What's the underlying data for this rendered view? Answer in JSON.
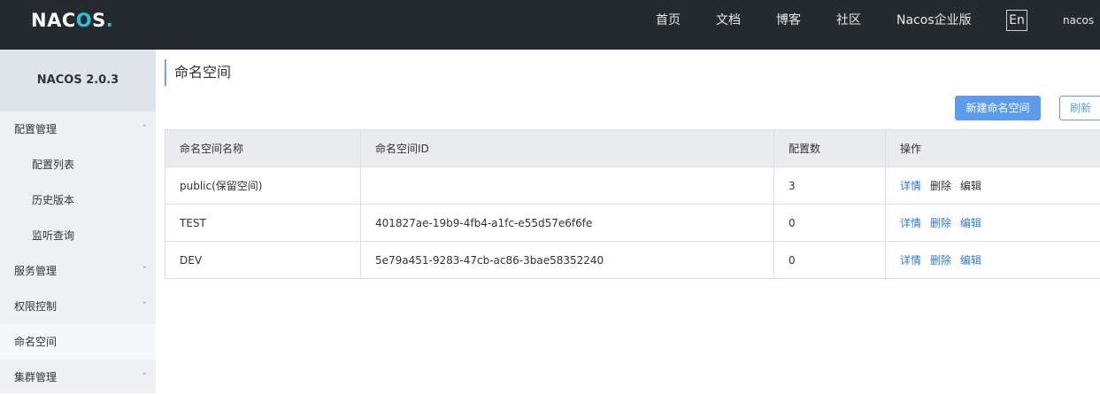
{
  "header": {
    "logo_parts": [
      "NAC",
      "O",
      "S",
      "."
    ],
    "nav": [
      "首页",
      "文档",
      "博客",
      "社区",
      "Nacos企业版"
    ],
    "lang": "En",
    "user": "nacos"
  },
  "sidebar": {
    "version": "NACOS 2.0.3",
    "items": [
      {
        "label": "配置管理",
        "level": 1,
        "chevron": "up"
      },
      {
        "label": "配置列表",
        "level": 2
      },
      {
        "label": "历史版本",
        "level": 2
      },
      {
        "label": "监听查询",
        "level": 2
      },
      {
        "label": "服务管理",
        "level": 1,
        "chevron": "down"
      },
      {
        "label": "权限控制",
        "level": 1,
        "chevron": "down"
      },
      {
        "label": "命名空间",
        "level": 1,
        "active": true
      },
      {
        "label": "集群管理",
        "level": 1,
        "chevron": "down"
      }
    ]
  },
  "main": {
    "title": "命名空间",
    "new_button": "新建命名空间",
    "refresh_button": "刷新",
    "table": {
      "columns": [
        "命名空间名称",
        "命名空间ID",
        "配置数",
        "操作"
      ],
      "rows": [
        {
          "name": "public(保留空间)",
          "id": "",
          "count": "3",
          "ops": [
            "详情",
            "删除",
            "编辑"
          ]
        },
        {
          "name": "TEST",
          "id": "401827ae-19b9-4fb4-a1fc-e55d57e6f6fe",
          "count": "0",
          "ops": [
            "详情",
            "删除",
            "编辑"
          ]
        },
        {
          "name": "DEV",
          "id": "5e79a451-9283-47cb-ac86-3bae58352240",
          "count": "0",
          "ops": [
            "详情",
            "删除",
            "编辑"
          ]
        }
      ]
    }
  },
  "colors": {
    "topbar": "#252a2f",
    "accent": "#5d9cec",
    "link": "#2f7bc9",
    "logo_accent": "#2fc0d3"
  }
}
